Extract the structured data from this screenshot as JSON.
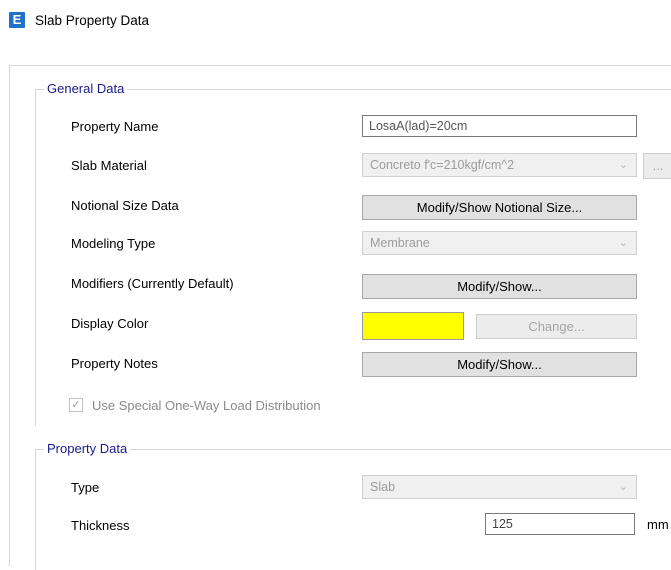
{
  "window": {
    "title": "Slab Property Data",
    "icon_letter": "E"
  },
  "general_data": {
    "legend": "General Data",
    "property_name": {
      "label": "Property Name",
      "value": "LosaA(lad)=20cm"
    },
    "slab_material": {
      "label": "Slab Material",
      "value": "Concreto f'c=210kgf/cm^2",
      "extra_button": "..."
    },
    "notional_size": {
      "label": "Notional Size Data",
      "button": "Modify/Show Notional Size..."
    },
    "modeling_type": {
      "label": "Modeling Type",
      "value": "Membrane"
    },
    "modifiers": {
      "label": "Modifiers (Currently Default)",
      "button": "Modify/Show..."
    },
    "display_color": {
      "label": "Display Color",
      "color": "#ffff00",
      "button": "Change..."
    },
    "property_notes": {
      "label": "Property Notes",
      "button": "Modify/Show..."
    },
    "one_way": {
      "label": "Use Special One-Way Load Distribution",
      "checked": true
    }
  },
  "property_data": {
    "legend": "Property Data",
    "type": {
      "label": "Type",
      "value": "Slab"
    },
    "thickness": {
      "label": "Thickness",
      "value": "125",
      "unit": "mm"
    }
  }
}
